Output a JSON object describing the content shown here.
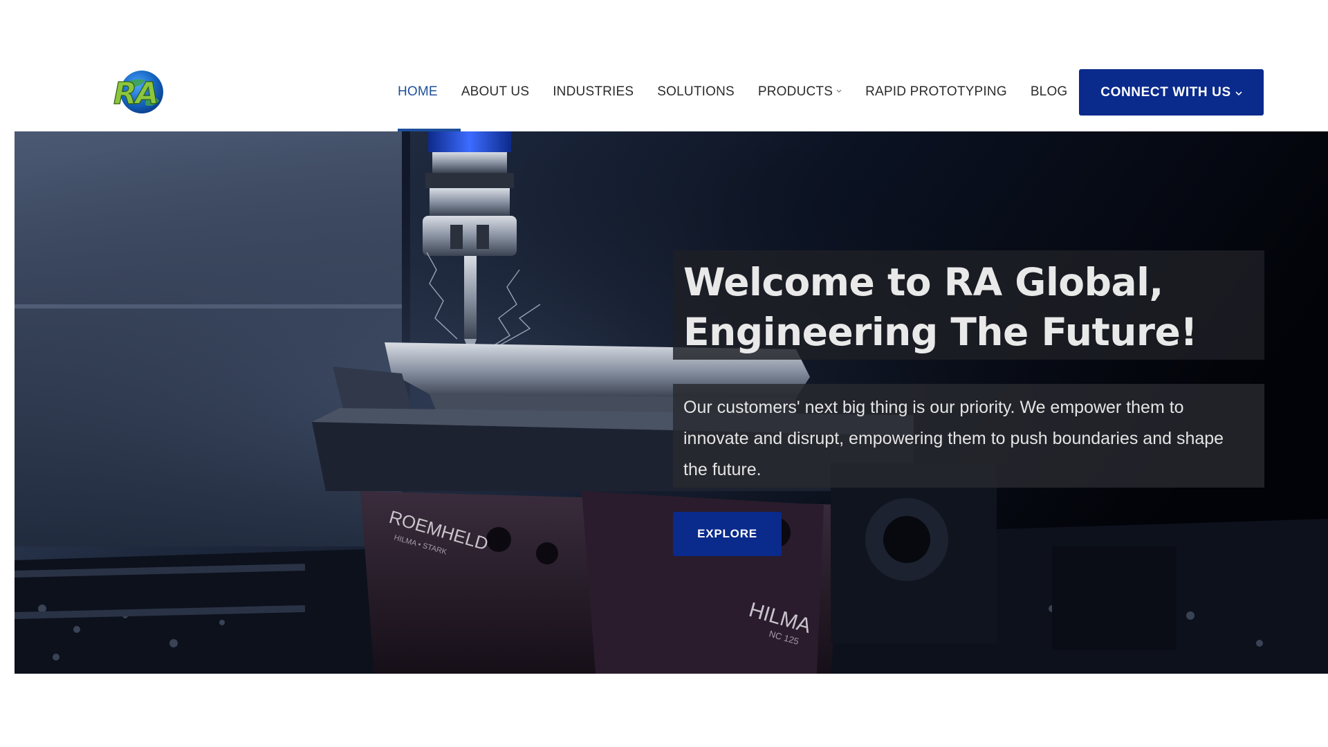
{
  "brand": {
    "logo_text": "RA",
    "logo_alt": "RA Global logo"
  },
  "nav": {
    "items": [
      {
        "label": "HOME",
        "active": true,
        "has_dropdown": false
      },
      {
        "label": "ABOUT US",
        "active": false,
        "has_dropdown": false
      },
      {
        "label": "INDUSTRIES",
        "active": false,
        "has_dropdown": false
      },
      {
        "label": "SOLUTIONS",
        "active": false,
        "has_dropdown": false
      },
      {
        "label": "PRODUCTS",
        "active": false,
        "has_dropdown": true
      },
      {
        "label": "RAPID PROTOTYPING",
        "active": false,
        "has_dropdown": false
      },
      {
        "label": "BLOG",
        "active": false,
        "has_dropdown": false
      }
    ],
    "cta_label": "CONNECT WITH US"
  },
  "hero": {
    "title": "Welcome to RA Global, Engineering The Future!",
    "description": "Our customers' next big thing is our priority. We empower them to innovate and disrupt, empowering them to push boundaries and shape the future.",
    "button_label": "EXPLORE",
    "image_subject": "cnc-milling-machine",
    "machine_markings": [
      "ROEMHELD",
      "HILMA • STARK",
      "HILMA",
      "NC 125"
    ]
  },
  "colors": {
    "accent": "#0a2a8c",
    "active_nav": "#1d4f9b",
    "nav_text": "#2b2b2b",
    "logo_green": "#8cc63f",
    "logo_blue": "#1565c0"
  }
}
